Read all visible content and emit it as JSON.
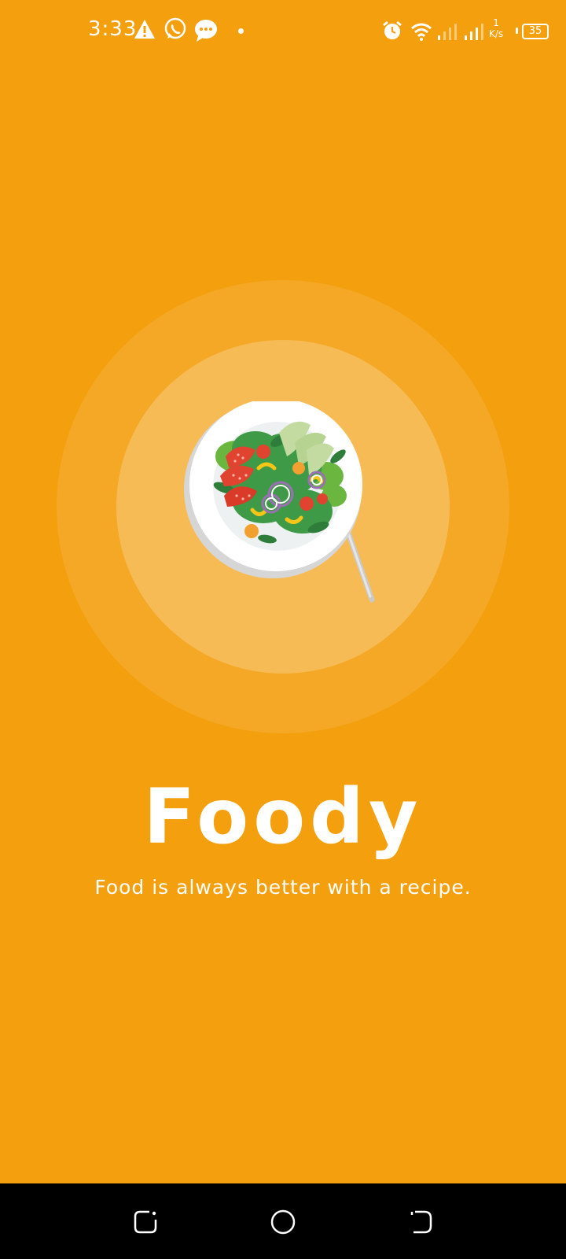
{
  "status_bar": {
    "time": "3:33",
    "net_speed_value": "1",
    "net_speed_unit": "K/s",
    "battery": "35",
    "icons": [
      "warning-icon",
      "whatsapp-icon",
      "message-icon",
      "notification-dot",
      "alarm-icon",
      "wifi-icon",
      "signal-icon-1",
      "signal-icon-2",
      "battery-icon"
    ]
  },
  "app": {
    "title": "Foody",
    "tagline": "Food is always better with a recipe."
  },
  "nav_bar": {
    "buttons": [
      "recent-apps-button",
      "home-button",
      "back-button"
    ]
  },
  "colors": {
    "background": "#F49F0E",
    "ring_outer": "rgba(255,255,255,0.10)",
    "ring_inner": "rgba(255,255,255,0.22)",
    "nav_background": "#000000"
  }
}
